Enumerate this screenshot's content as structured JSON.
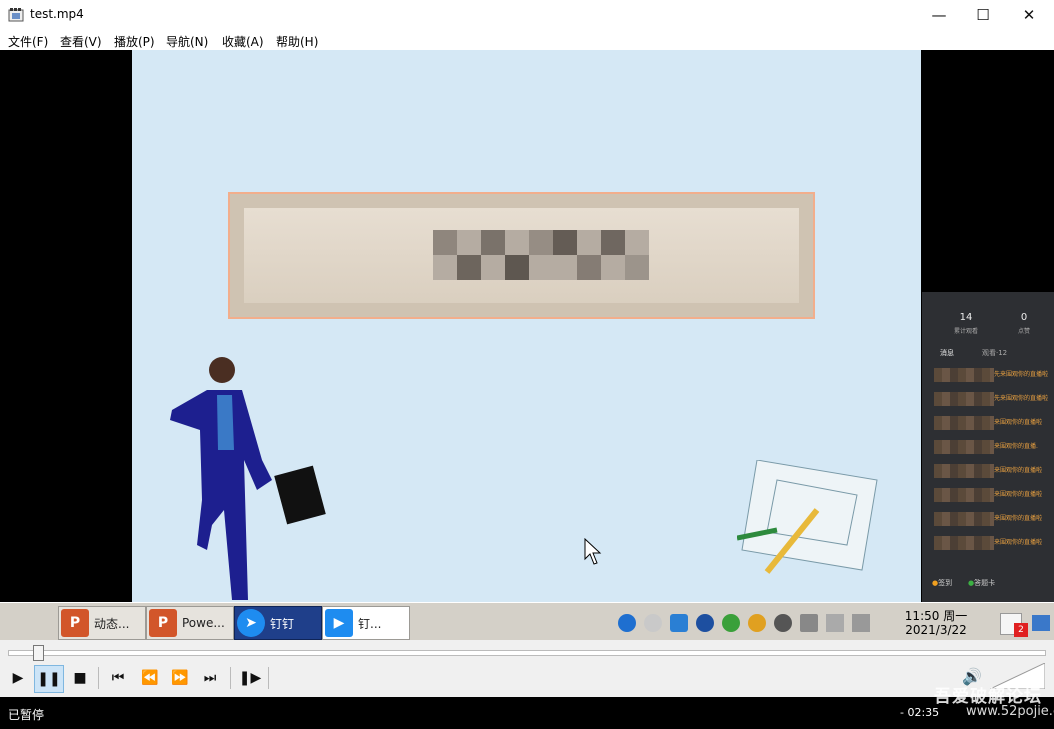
{
  "window": {
    "title": "test.mp4"
  },
  "menu": {
    "items": [
      "文件(F)",
      "查看(V)",
      "播放(P)",
      "导航(N)",
      "收藏(A)",
      "帮助(H)"
    ]
  },
  "chat_panel": {
    "stat1_value": "14",
    "stat1_label": "累计观看",
    "stat2_value": "0",
    "stat2_label": "点赞",
    "tab1": "消息",
    "tab2": "观看·12",
    "lines": [
      "先来围观你的直播啦",
      "先来围观你的直播啦",
      "来围观你的直播啦",
      "来围观你的直播.",
      "来围观你的直播啦",
      "来围观你的直播啦",
      "来围观你的直播啦",
      "来围观你的直播啦"
    ],
    "footer1": "签到",
    "footer2": "答题卡"
  },
  "video_taskbar": {
    "tasks": [
      {
        "label": "动态...",
        "icon_color": "#d2562a"
      },
      {
        "label": "Powe...",
        "icon_color": "#d2562a"
      },
      {
        "label": "钉钉",
        "icon_color": "#1e8cf0"
      },
      {
        "label": "钉...",
        "icon_color": "#1e8cf0"
      }
    ],
    "clock_time": "11:50 周一",
    "clock_date": "2021/3/22",
    "notify_badge": "2"
  },
  "status": {
    "state": "已暂停",
    "time": "- 02:35",
    "watermark": "吾爱破解论坛",
    "watermark_url": "www.52pojie.cn"
  },
  "colors": {
    "accent": "#1f3f8a",
    "slide_bg": "#d5e8f5",
    "status_bg": "#000000"
  },
  "icons": [
    "film-icon",
    "minimize-icon",
    "maximize-icon",
    "close-icon",
    "play-icon",
    "pause-icon",
    "stop-icon",
    "previous-icon",
    "rewind-icon",
    "forward-icon",
    "next-icon",
    "frame-step-icon",
    "volume-icon"
  ]
}
